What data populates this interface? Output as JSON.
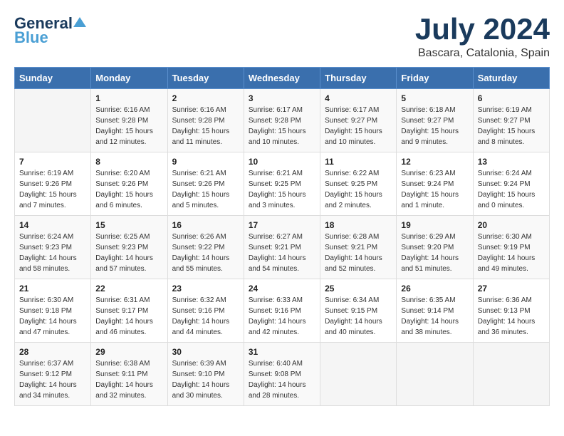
{
  "header": {
    "logo_general": "General",
    "logo_blue": "Blue",
    "month_year": "July 2024",
    "location": "Bascara, Catalonia, Spain"
  },
  "columns": [
    "Sunday",
    "Monday",
    "Tuesday",
    "Wednesday",
    "Thursday",
    "Friday",
    "Saturday"
  ],
  "weeks": [
    [
      {
        "day": "",
        "info": ""
      },
      {
        "day": "1",
        "info": "Sunrise: 6:16 AM\nSunset: 9:28 PM\nDaylight: 15 hours\nand 12 minutes."
      },
      {
        "day": "2",
        "info": "Sunrise: 6:16 AM\nSunset: 9:28 PM\nDaylight: 15 hours\nand 11 minutes."
      },
      {
        "day": "3",
        "info": "Sunrise: 6:17 AM\nSunset: 9:28 PM\nDaylight: 15 hours\nand 10 minutes."
      },
      {
        "day": "4",
        "info": "Sunrise: 6:17 AM\nSunset: 9:27 PM\nDaylight: 15 hours\nand 10 minutes."
      },
      {
        "day": "5",
        "info": "Sunrise: 6:18 AM\nSunset: 9:27 PM\nDaylight: 15 hours\nand 9 minutes."
      },
      {
        "day": "6",
        "info": "Sunrise: 6:19 AM\nSunset: 9:27 PM\nDaylight: 15 hours\nand 8 minutes."
      }
    ],
    [
      {
        "day": "7",
        "info": "Sunrise: 6:19 AM\nSunset: 9:26 PM\nDaylight: 15 hours\nand 7 minutes."
      },
      {
        "day": "8",
        "info": "Sunrise: 6:20 AM\nSunset: 9:26 PM\nDaylight: 15 hours\nand 6 minutes."
      },
      {
        "day": "9",
        "info": "Sunrise: 6:21 AM\nSunset: 9:26 PM\nDaylight: 15 hours\nand 5 minutes."
      },
      {
        "day": "10",
        "info": "Sunrise: 6:21 AM\nSunset: 9:25 PM\nDaylight: 15 hours\nand 3 minutes."
      },
      {
        "day": "11",
        "info": "Sunrise: 6:22 AM\nSunset: 9:25 PM\nDaylight: 15 hours\nand 2 minutes."
      },
      {
        "day": "12",
        "info": "Sunrise: 6:23 AM\nSunset: 9:24 PM\nDaylight: 15 hours\nand 1 minute."
      },
      {
        "day": "13",
        "info": "Sunrise: 6:24 AM\nSunset: 9:24 PM\nDaylight: 15 hours\nand 0 minutes."
      }
    ],
    [
      {
        "day": "14",
        "info": "Sunrise: 6:24 AM\nSunset: 9:23 PM\nDaylight: 14 hours\nand 58 minutes."
      },
      {
        "day": "15",
        "info": "Sunrise: 6:25 AM\nSunset: 9:23 PM\nDaylight: 14 hours\nand 57 minutes."
      },
      {
        "day": "16",
        "info": "Sunrise: 6:26 AM\nSunset: 9:22 PM\nDaylight: 14 hours\nand 55 minutes."
      },
      {
        "day": "17",
        "info": "Sunrise: 6:27 AM\nSunset: 9:21 PM\nDaylight: 14 hours\nand 54 minutes."
      },
      {
        "day": "18",
        "info": "Sunrise: 6:28 AM\nSunset: 9:21 PM\nDaylight: 14 hours\nand 52 minutes."
      },
      {
        "day": "19",
        "info": "Sunrise: 6:29 AM\nSunset: 9:20 PM\nDaylight: 14 hours\nand 51 minutes."
      },
      {
        "day": "20",
        "info": "Sunrise: 6:30 AM\nSunset: 9:19 PM\nDaylight: 14 hours\nand 49 minutes."
      }
    ],
    [
      {
        "day": "21",
        "info": "Sunrise: 6:30 AM\nSunset: 9:18 PM\nDaylight: 14 hours\nand 47 minutes."
      },
      {
        "day": "22",
        "info": "Sunrise: 6:31 AM\nSunset: 9:17 PM\nDaylight: 14 hours\nand 46 minutes."
      },
      {
        "day": "23",
        "info": "Sunrise: 6:32 AM\nSunset: 9:16 PM\nDaylight: 14 hours\nand 44 minutes."
      },
      {
        "day": "24",
        "info": "Sunrise: 6:33 AM\nSunset: 9:16 PM\nDaylight: 14 hours\nand 42 minutes."
      },
      {
        "day": "25",
        "info": "Sunrise: 6:34 AM\nSunset: 9:15 PM\nDaylight: 14 hours\nand 40 minutes."
      },
      {
        "day": "26",
        "info": "Sunrise: 6:35 AM\nSunset: 9:14 PM\nDaylight: 14 hours\nand 38 minutes."
      },
      {
        "day": "27",
        "info": "Sunrise: 6:36 AM\nSunset: 9:13 PM\nDaylight: 14 hours\nand 36 minutes."
      }
    ],
    [
      {
        "day": "28",
        "info": "Sunrise: 6:37 AM\nSunset: 9:12 PM\nDaylight: 14 hours\nand 34 minutes."
      },
      {
        "day": "29",
        "info": "Sunrise: 6:38 AM\nSunset: 9:11 PM\nDaylight: 14 hours\nand 32 minutes."
      },
      {
        "day": "30",
        "info": "Sunrise: 6:39 AM\nSunset: 9:10 PM\nDaylight: 14 hours\nand 30 minutes."
      },
      {
        "day": "31",
        "info": "Sunrise: 6:40 AM\nSunset: 9:08 PM\nDaylight: 14 hours\nand 28 minutes."
      },
      {
        "day": "",
        "info": ""
      },
      {
        "day": "",
        "info": ""
      },
      {
        "day": "",
        "info": ""
      }
    ]
  ]
}
